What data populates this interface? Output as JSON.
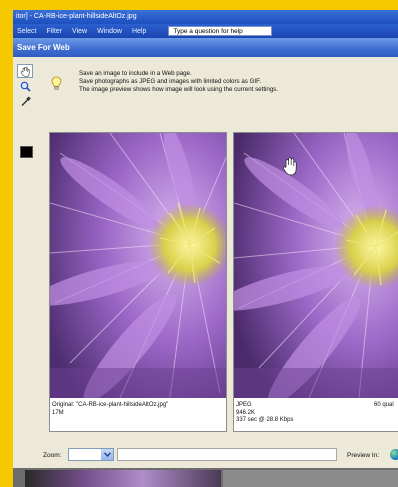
{
  "window": {
    "title": "itor] - CA-RB-ice-plant-hillsideAltOz.jpg"
  },
  "menu": {
    "items": [
      "Select",
      "Filter",
      "View",
      "Window",
      "Help"
    ],
    "help_placeholder": "Type a question for help"
  },
  "dialog": {
    "title": "Save For Web"
  },
  "tools": {
    "hand": "hand-icon",
    "zoom": "zoom-icon",
    "eyedropper": "eyedropper-icon",
    "swatch_color": "#000000"
  },
  "info": {
    "lines": [
      "Save an image to include in a Web page.",
      "Save photographs as JPEG and images with limited colors as GIF.",
      "The image preview shows how image will look using the current settings."
    ]
  },
  "preview": {
    "original": {
      "name_line": "Original: \"CA-RB-ice-plant-hillsideAltOz.jpg\"",
      "size_line": "17M"
    },
    "optimized": {
      "format": "JPEG",
      "size": "946.2K",
      "time": "337 sec @ 28.8 Kbps",
      "quality": "60 qual"
    }
  },
  "footer": {
    "zoom_label": "Zoom:",
    "preview_in_label": "Preview In:"
  },
  "colors": {
    "accent": "#2c5fcf",
    "frame": "#f5c800"
  }
}
